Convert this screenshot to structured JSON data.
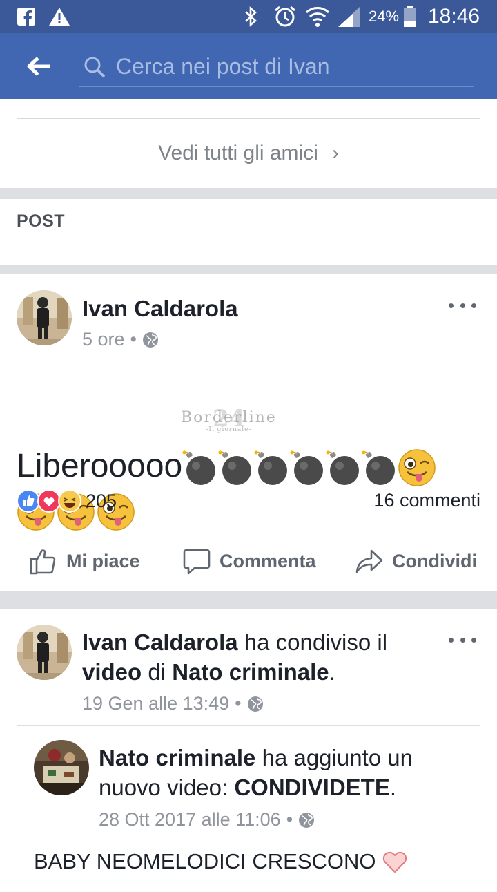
{
  "status_bar": {
    "battery": "24%",
    "time": "18:46",
    "icons": [
      "facebook-notification-icon",
      "warning-icon",
      "bluetooth-icon",
      "alarm-icon",
      "wifi-icon",
      "signal-icon",
      "battery-icon"
    ]
  },
  "header": {
    "search_placeholder": "Cerca nei post di Ivan",
    "accent": "#4267b2",
    "statusbar_color": "#3b5998"
  },
  "friends": {
    "see_all_label": "Vedi tutti gli amici",
    "chevron": "›"
  },
  "posts_section": {
    "title": "POST"
  },
  "post1": {
    "author": "Ivan Caldarola",
    "time": "5 ore",
    "text": "Liberooooo",
    "emoji_bombs": 6,
    "emoji_winks": 4,
    "reactions": [
      "like",
      "love",
      "haha"
    ],
    "reaction_count": "205",
    "comment_count": "16 commenti",
    "watermark": "Borderline",
    "watermark_number": "24",
    "watermark_sub": "-Il giornale-"
  },
  "actions": {
    "like": "Mi piace",
    "comment": "Commenta",
    "share": "Condividi"
  },
  "post2": {
    "author": "Ivan Caldarola",
    "verb": " ha condiviso il",
    "object": "video",
    "prep": " di ",
    "page": "Nato criminale",
    "end": ".",
    "time": "19 Gen alle 13:49"
  },
  "shared": {
    "author": "Nato criminale",
    "verb": " ha aggiunto un",
    "line2_prefix": "nuovo video: ",
    "title": "CONDIVIDETE",
    "end": ".",
    "time": "28 Ott 2017 alle 11:06",
    "text": "BABY NEOMELODICI CRESCONO"
  }
}
